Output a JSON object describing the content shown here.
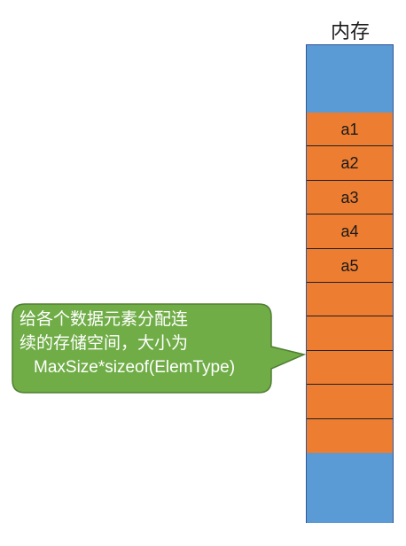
{
  "memory": {
    "title": "内存",
    "cells": [
      "a1",
      "a2",
      "a3",
      "a4",
      "a5",
      "",
      "",
      "",
      "",
      ""
    ]
  },
  "callout": {
    "lines": [
      "给各个数据元素分配连",
      "续的存储空间，大小为",
      "MaxSize*sizeof(ElemType)"
    ]
  },
  "colors": {
    "memory_free": "#5b9bd5",
    "memory_allocated": "#ed7d31",
    "callout_fill": "#70ad47",
    "callout_border": "#507e32"
  }
}
